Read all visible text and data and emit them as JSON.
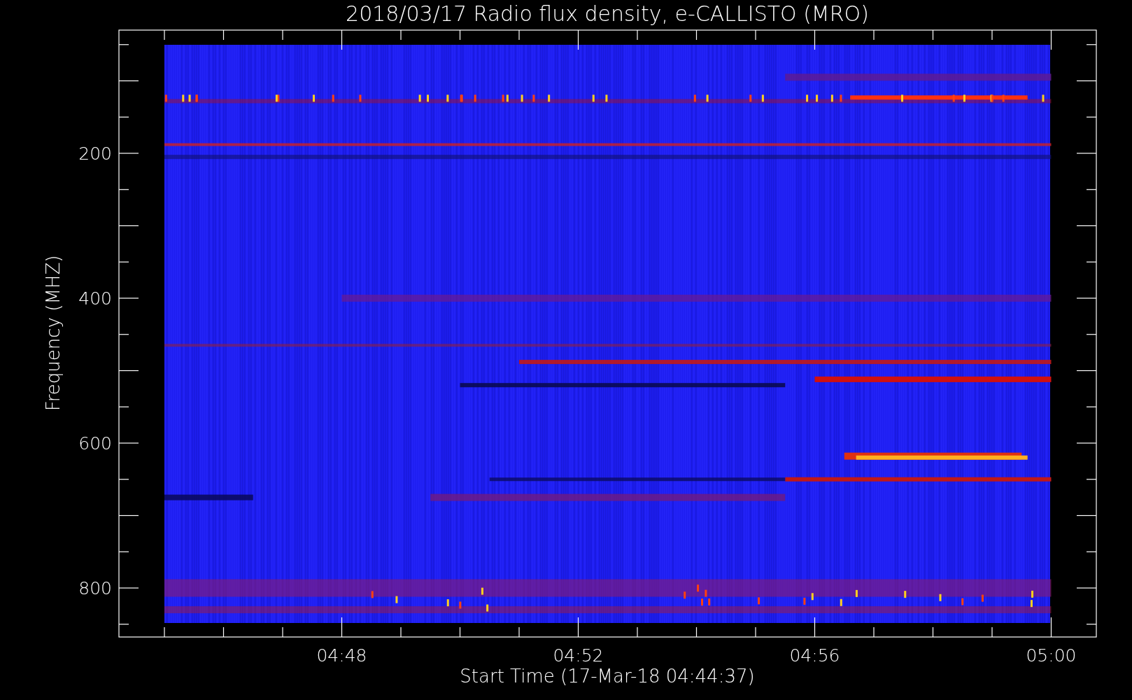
{
  "title": "2018/03/17  Radio flux density, e-CALLISTO (MRO)",
  "ylabel": "Frequency (MHZ)",
  "xlabel": "Start Time (17-Mar-18 04:44:37)",
  "y_tick_labels": [
    "200",
    "400",
    "600",
    "800"
  ],
  "x_tick_labels": [
    "04:48",
    "04:52",
    "04:56",
    "05:00"
  ]
}
